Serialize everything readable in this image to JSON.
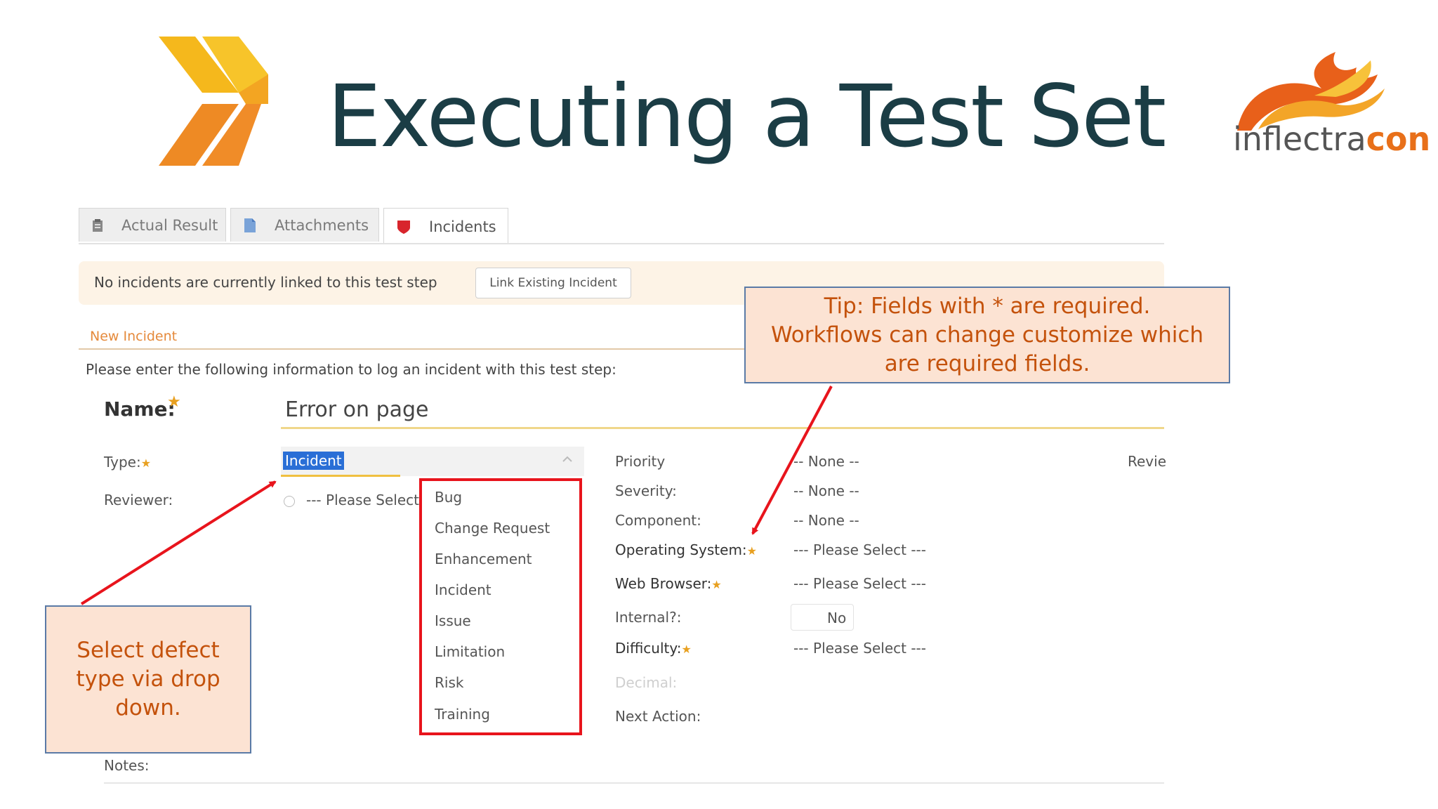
{
  "slide": {
    "title": "Executing a Test Set",
    "brand": {
      "part1": "inflectra",
      "part2": "con"
    }
  },
  "tabs": [
    {
      "label": "Actual Result",
      "icon": "clipboard-icon"
    },
    {
      "label": "Attachments",
      "icon": "document-icon"
    },
    {
      "label": "Incidents",
      "icon": "bug-shield-icon",
      "active": true
    }
  ],
  "info": {
    "message": "No incidents are currently linked to this test step",
    "link_button": "Link Existing Incident"
  },
  "new_incident": {
    "section_label": "New Incident",
    "instructions": "Please enter the following information to log an incident with this test step:",
    "name_label": "Name:",
    "name_value": "Error on page",
    "type_label": "Type:",
    "type_value": "Incident",
    "reviewer_label": "Reviewer:",
    "reviewer_value": "--- Please Select",
    "notes_label": "Notes:"
  },
  "type_options": [
    "Bug",
    "Change Request",
    "Enhancement",
    "Incident",
    "Issue",
    "Limitation",
    "Risk",
    "Training"
  ],
  "fields": {
    "priority": {
      "label": "Priority",
      "value": "-- None --"
    },
    "severity": {
      "label": "Severity:",
      "value": "-- None --"
    },
    "component": {
      "label": "Component:",
      "value": "-- None --"
    },
    "os": {
      "label": "Operating System:",
      "value": "--- Please Select ---"
    },
    "browser": {
      "label": "Web Browser:",
      "value": "--- Please Select ---"
    },
    "internal": {
      "label": "Internal?:",
      "value": "No"
    },
    "difficulty": {
      "label": "Difficulty:",
      "value": "--- Please Select ---"
    },
    "decimal": {
      "label": "Decimal:"
    },
    "next_action": {
      "label": "Next Action:"
    },
    "review_cut": "Revie"
  },
  "callouts": {
    "tip": [
      "Tip: Fields with * are required.",
      "Workflows can change customize which",
      "are required fields."
    ],
    "select": [
      "Select defect",
      "type via drop",
      "down."
    ]
  },
  "colors": {
    "title": "#1b3d45",
    "callout_text": "#c4520c",
    "callout_bg": "#fce3d3",
    "arrow": "#e8141c",
    "selection": "#2a6fd6",
    "required_star": "#e8a020"
  }
}
